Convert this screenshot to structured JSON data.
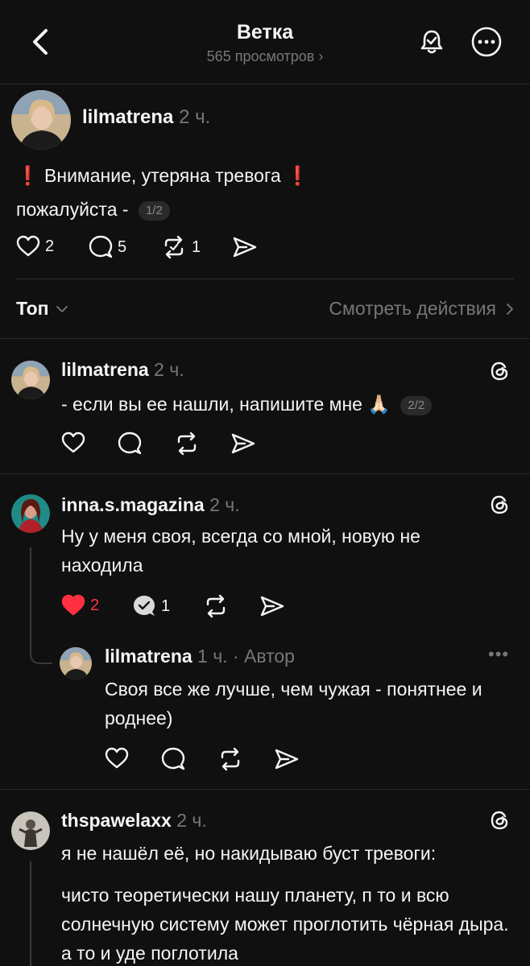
{
  "header": {
    "title": "Ветка",
    "views": "565 просмотров"
  },
  "post": {
    "username": "lilmatrena",
    "time": "2 ч.",
    "line1_text": "Внимание, утеряна тревога",
    "line2_text": "пожалуйста -",
    "page_badge": "1/2",
    "likes": "2",
    "replies": "5",
    "reposts": "1"
  },
  "sort": {
    "label": "Топ",
    "activity_link": "Смотреть действия"
  },
  "replies": [
    {
      "username": "lilmatrena",
      "time": "2 ч.",
      "text": "- если вы ее нашли, напишите мне",
      "page_badge": "2/2"
    },
    {
      "username": "inna.s.magazina",
      "time": "2 ч.",
      "text": "Ну у меня своя, всегда со мной, новую не находила",
      "likes": "2",
      "replies": "1",
      "liked": true,
      "colors": {
        "like": "#ff3040"
      }
    },
    {
      "username": "lilmatrena",
      "time": "1 ч.",
      "author_tag": "· Автор",
      "text": "Своя все же лучше, чем чужая - понятнее и роднее)"
    },
    {
      "username": "thspawelaxx",
      "time": "2 ч.",
      "text1": "я не нашёл её, но накидываю буст тревоги:",
      "text2": "чисто теоретически нашу планету, п то и всю солнечную систему может проглотить чёрная дыра. а то и уде поглотила"
    }
  ],
  "icons": {
    "back": "chevron-left-icon",
    "bell": "bell-icon",
    "more": "more-circle-icon",
    "like": "heart-icon",
    "comment": "comment-icon",
    "repost": "repost-icon",
    "share": "share-icon",
    "threads": "threads-logo-icon",
    "prayer_emoji": "🙏🏻",
    "exclamation_emoji": "❗"
  },
  "colors": {
    "background": "#101010",
    "text": "#f3f5f7",
    "muted": "#777777",
    "accent_red": "#ff3040"
  }
}
